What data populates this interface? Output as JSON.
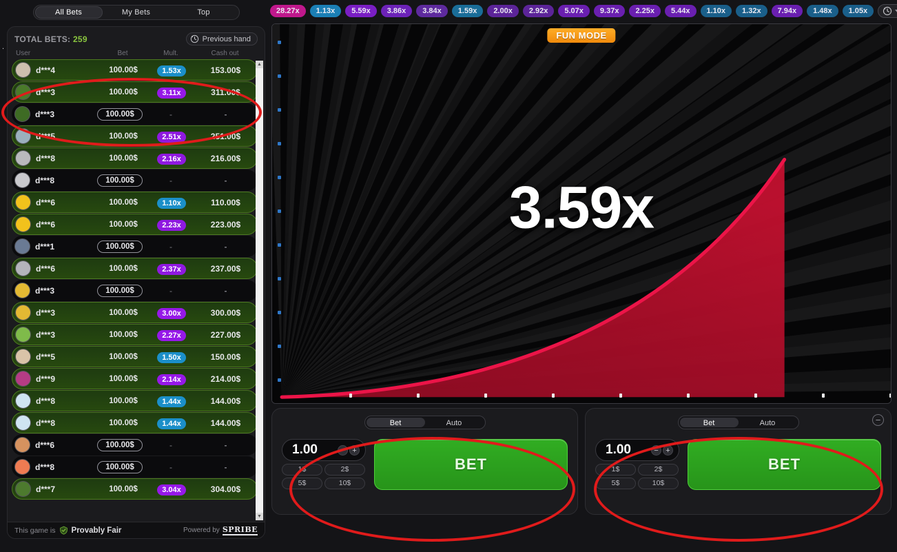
{
  "left_panel": {
    "tabs": [
      {
        "label": "All Bets",
        "active": true
      },
      {
        "label": "My Bets",
        "active": false
      },
      {
        "label": "Top",
        "active": false
      }
    ],
    "total_bets_label": "TOTAL BETS:",
    "total_bets_count": "259",
    "previous_hand_label": "Previous hand",
    "previous_hand_icon": "clock-history-icon",
    "columns": [
      "User",
      "Bet",
      "Mult.",
      "Cash out"
    ],
    "footer": {
      "prefix": "This game is",
      "provably_fair": "Provably Fair",
      "shield_icon": "shield-check-icon",
      "powered_by": "Powered by",
      "brand": "SPRIBE"
    },
    "rows": [
      {
        "user": "d***4",
        "bet": "100.00$",
        "mult": "1.53x",
        "cashout": "153.00$",
        "win": true,
        "mult_color": "#1b8fc9",
        "avatar": "#cdbfae"
      },
      {
        "user": "d***3",
        "bet": "100.00$",
        "mult": "3.11x",
        "cashout": "311.00$",
        "win": true,
        "mult_color": "#9618e8",
        "avatar": "#4a7a2a"
      },
      {
        "user": "d***3",
        "bet": "100.00$",
        "mult": "-",
        "cashout": "-",
        "win": false,
        "mult_color": "",
        "avatar": "#3e6b24"
      },
      {
        "user": "d***5",
        "bet": "100.00$",
        "mult": "2.51x",
        "cashout": "251.00$",
        "win": true,
        "mult_color": "#8f19e0",
        "avatar": "#9bb0bd"
      },
      {
        "user": "d***8",
        "bet": "100.00$",
        "mult": "2.16x",
        "cashout": "216.00$",
        "win": true,
        "mult_color": "#8f19e0",
        "avatar": "#b9b9bd"
      },
      {
        "user": "d***8",
        "bet": "100.00$",
        "mult": "-",
        "cashout": "-",
        "win": false,
        "mult_color": "",
        "avatar": "#c9c9cd"
      },
      {
        "user": "d***6",
        "bet": "100.00$",
        "mult": "1.10x",
        "cashout": "110.00$",
        "win": true,
        "mult_color": "#1b8fc9",
        "avatar": "#f2c21c"
      },
      {
        "user": "d***6",
        "bet": "100.00$",
        "mult": "2.23x",
        "cashout": "223.00$",
        "win": true,
        "mult_color": "#8f19e0",
        "avatar": "#f2c21c"
      },
      {
        "user": "d***1",
        "bet": "100.00$",
        "mult": "-",
        "cashout": "-",
        "win": false,
        "mult_color": "",
        "avatar": "#6a7a94"
      },
      {
        "user": "d***6",
        "bet": "100.00$",
        "mult": "2.37x",
        "cashout": "237.00$",
        "win": true,
        "mult_color": "#8f19e0",
        "avatar": "#b4b4bb"
      },
      {
        "user": "d***3",
        "bet": "100.00$",
        "mult": "-",
        "cashout": "-",
        "win": false,
        "mult_color": "",
        "avatar": "#e3b933"
      },
      {
        "user": "d***3",
        "bet": "100.00$",
        "mult": "3.00x",
        "cashout": "300.00$",
        "win": true,
        "mult_color": "#9618e8",
        "avatar": "#e3b933"
      },
      {
        "user": "d***3",
        "bet": "100.00$",
        "mult": "2.27x",
        "cashout": "227.00$",
        "win": true,
        "mult_color": "#9618e8",
        "avatar": "#7fbb4a"
      },
      {
        "user": "d***5",
        "bet": "100.00$",
        "mult": "1.50x",
        "cashout": "150.00$",
        "win": true,
        "mult_color": "#1b8fc9",
        "avatar": "#d9c3a8"
      },
      {
        "user": "d***9",
        "bet": "100.00$",
        "mult": "2.14x",
        "cashout": "214.00$",
        "win": true,
        "mult_color": "#9618e8",
        "avatar": "#b53c84"
      },
      {
        "user": "d***8",
        "bet": "100.00$",
        "mult": "1.44x",
        "cashout": "144.00$",
        "win": true,
        "mult_color": "#1b8fc9",
        "avatar": "#cfe4f2"
      },
      {
        "user": "d***8",
        "bet": "100.00$",
        "mult": "1.44x",
        "cashout": "144.00$",
        "win": true,
        "mult_color": "#1b8fc9",
        "avatar": "#cfe4f2"
      },
      {
        "user": "d***6",
        "bet": "100.00$",
        "mult": "-",
        "cashout": "-",
        "win": false,
        "mult_color": "",
        "avatar": "#d6925f"
      },
      {
        "user": "d***8",
        "bet": "100.00$",
        "mult": "-",
        "cashout": "-",
        "win": false,
        "mult_color": "",
        "avatar": "#ef7b52"
      },
      {
        "user": "d***7",
        "bet": "100.00$",
        "mult": "3.04x",
        "cashout": "304.00$",
        "win": true,
        "mult_color": "#9618e8",
        "avatar": "#4d7a2e"
      }
    ]
  },
  "history": {
    "chips": [
      {
        "value": "28.27x",
        "color": "#c0188c"
      },
      {
        "value": "1.13x",
        "color": "#1b7fb5"
      },
      {
        "value": "5.59x",
        "color": "#7a1ec4"
      },
      {
        "value": "3.86x",
        "color": "#6c22b8"
      },
      {
        "value": "3.84x",
        "color": "#5e2a9e"
      },
      {
        "value": "1.59x",
        "color": "#1a6d98"
      },
      {
        "value": "2.00x",
        "color": "#5c2499"
      },
      {
        "value": "2.92x",
        "color": "#5c2499"
      },
      {
        "value": "5.07x",
        "color": "#6a1fb0"
      },
      {
        "value": "9.37x",
        "color": "#6a1fb0"
      },
      {
        "value": "2.25x",
        "color": "#6a1fb0"
      },
      {
        "value": "5.44x",
        "color": "#6a1fb0"
      },
      {
        "value": "1.10x",
        "color": "#1a5f8a"
      },
      {
        "value": "1.32x",
        "color": "#1a5f8a"
      },
      {
        "value": "7.94x",
        "color": "#6a1fb0"
      },
      {
        "value": "1.48x",
        "color": "#1a5f8a"
      },
      {
        "value": "1.05x",
        "color": "#1a5f8a"
      }
    ],
    "history_button_icon": "clock-history-icon",
    "history_caret_icon": "chevron-down-icon"
  },
  "game": {
    "fun_mode_label": "FUN MODE",
    "multiplier": "3.59x",
    "plane_icon": "airplane-icon",
    "accent_red": "#e0123c",
    "fun_mode_color": "#f79a12"
  },
  "bet_panels": [
    {
      "id": "panel-left",
      "tabs": [
        {
          "label": "Bet",
          "active": true
        },
        {
          "label": "Auto",
          "active": false
        }
      ],
      "stake_value": "1.00",
      "minus_label": "−",
      "plus_label": "+",
      "quick_amounts": [
        "1$",
        "2$",
        "5$",
        "10$"
      ],
      "bet_button_label": "BET",
      "bet_button_color": "#2ca01d",
      "has_collapse": false
    },
    {
      "id": "panel-right",
      "tabs": [
        {
          "label": "Bet",
          "active": true
        },
        {
          "label": "Auto",
          "active": false
        }
      ],
      "stake_value": "1.00",
      "minus_label": "−",
      "plus_label": "+",
      "quick_amounts": [
        "1$",
        "2$",
        "5$",
        "10$"
      ],
      "bet_button_label": "BET",
      "bet_button_color": "#2ca01d",
      "has_collapse": true,
      "collapse_label": "−"
    }
  ],
  "annotations": [
    {
      "name": "annotation-ellipse-bet-list"
    },
    {
      "name": "annotation-ellipse-bet-panel-left"
    },
    {
      "name": "annotation-ellipse-bet-panel-right"
    }
  ]
}
